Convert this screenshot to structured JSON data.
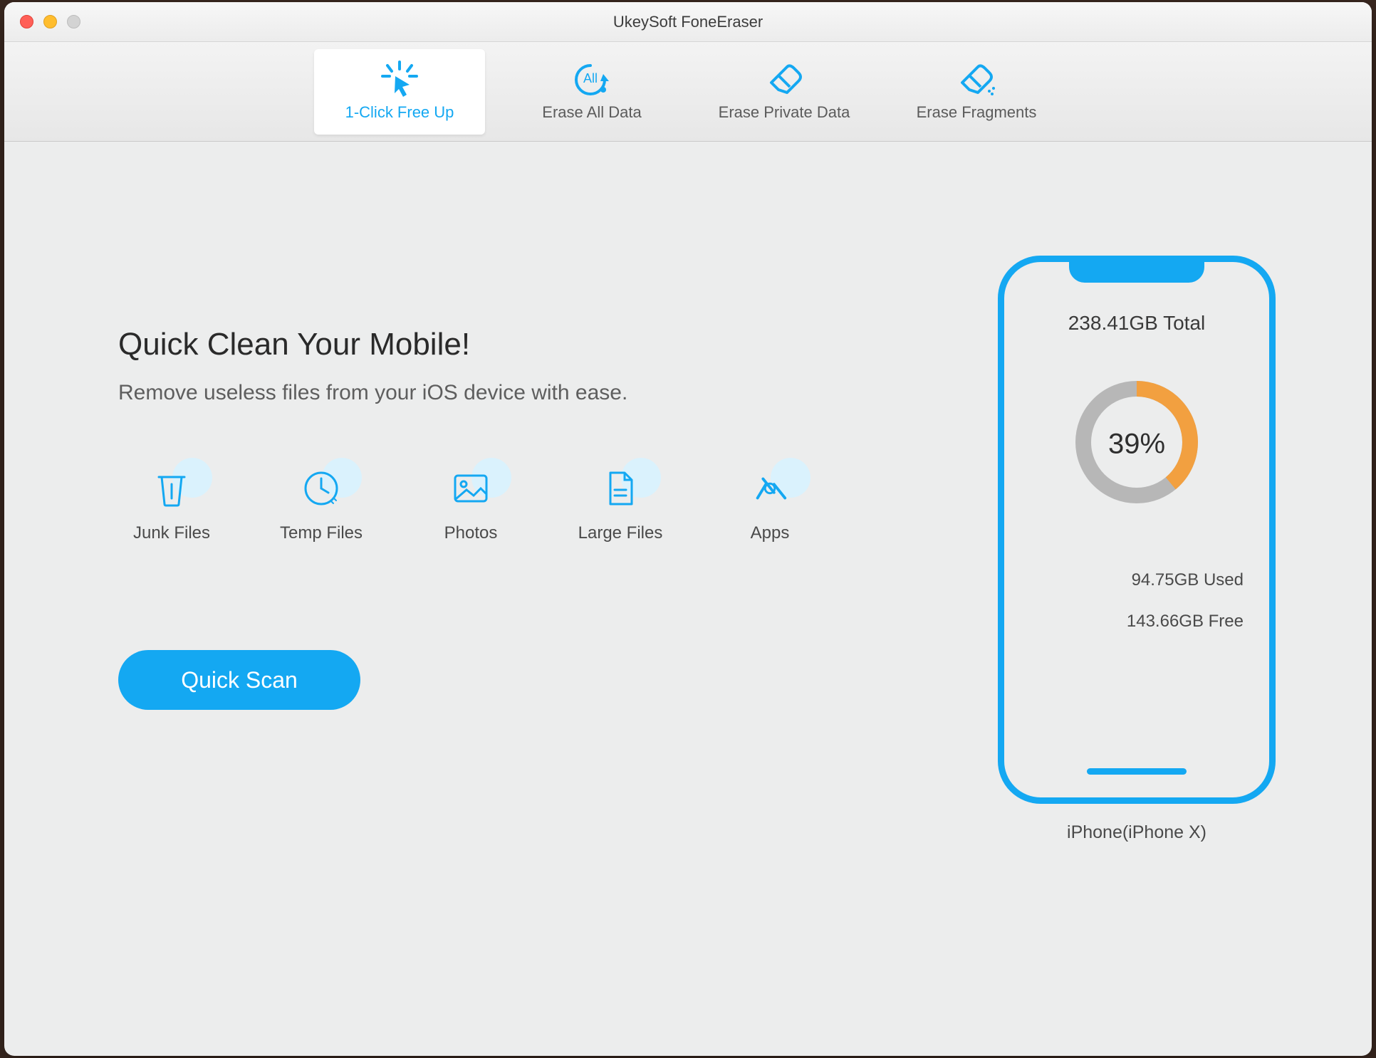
{
  "app": {
    "title": "UkeySoft FoneEraser"
  },
  "tabs": [
    {
      "label": "1-Click Free Up",
      "active": true
    },
    {
      "label": "Erase All Data",
      "active": false
    },
    {
      "label": "Erase Private Data",
      "active": false
    },
    {
      "label": "Erase Fragments",
      "active": false
    }
  ],
  "main": {
    "heading": "Quick Clean Your Mobile!",
    "subheading": "Remove useless files from your iOS device with ease.",
    "categories": [
      {
        "label": "Junk Files"
      },
      {
        "label": "Temp Files"
      },
      {
        "label": "Photos"
      },
      {
        "label": "Large Files"
      },
      {
        "label": "Apps"
      }
    ],
    "scan_button": "Quick Scan"
  },
  "device": {
    "total_label": "238.41GB Total",
    "used_percent": 39,
    "used_percent_label": "39%",
    "used_label": "94.75GB Used",
    "free_label": "143.66GB Free",
    "name": "iPhone(iPhone X)"
  },
  "colors": {
    "accent": "#14a8f2",
    "donut_used": "#f2a040",
    "donut_free": "#b7b7b7"
  },
  "chart_data": {
    "type": "pie",
    "title": "Storage usage",
    "categories": [
      "Used",
      "Free"
    ],
    "values": [
      39,
      61
    ],
    "series_labels": [
      "94.75GB Used",
      "143.66GB Free"
    ],
    "total": "238.41GB"
  }
}
